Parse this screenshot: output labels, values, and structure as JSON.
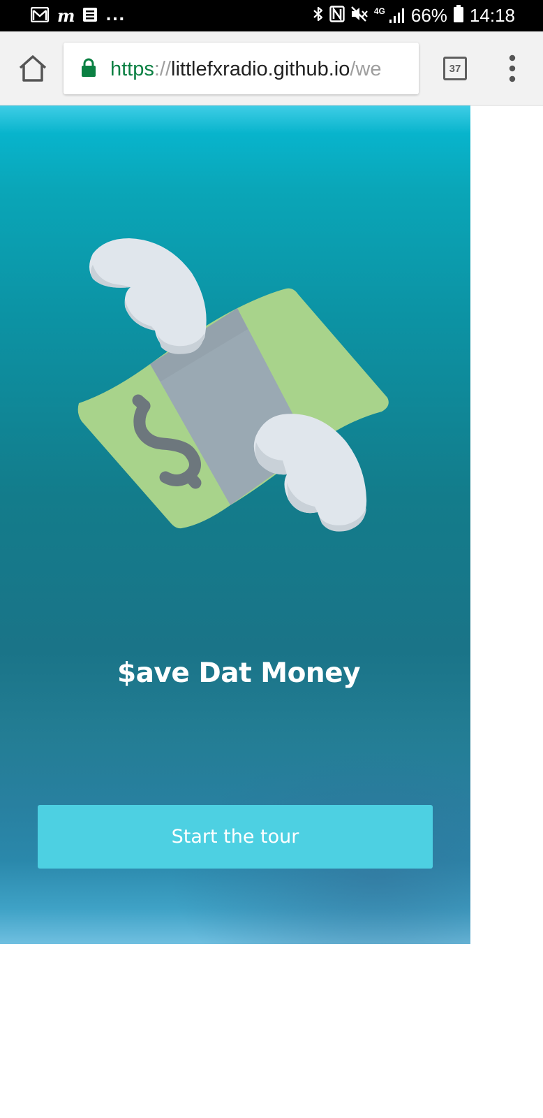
{
  "status_bar": {
    "left_icons": [
      "gmail-icon",
      "m-app-icon",
      "news-icon",
      "more-notifications-icon"
    ],
    "more_label": "...",
    "network_label": "4G",
    "battery_percent": "66%",
    "time": "14:18",
    "right_icons": [
      "bluetooth-icon",
      "nfc-icon",
      "muted-icon",
      "signal-icon",
      "battery-icon"
    ]
  },
  "browser": {
    "url_scheme": "https",
    "url_separator": "://",
    "url_host": "littlefxradio.github.io",
    "url_path": "/we",
    "tab_count": "37",
    "icons": [
      "home-icon",
      "lock-icon",
      "tabs-icon",
      "overflow-menu-icon"
    ]
  },
  "page": {
    "title": "$ave Dat Money",
    "start_button_label": "Start the tour",
    "illustration_icon": "flying-money-icon",
    "colors": {
      "button": "#4dd0e2",
      "bill_green": "#a8d38b",
      "band_gray": "#9aa9b3",
      "wing_light": "#e0e6ec",
      "dollar_sign": "#6d777d"
    }
  }
}
